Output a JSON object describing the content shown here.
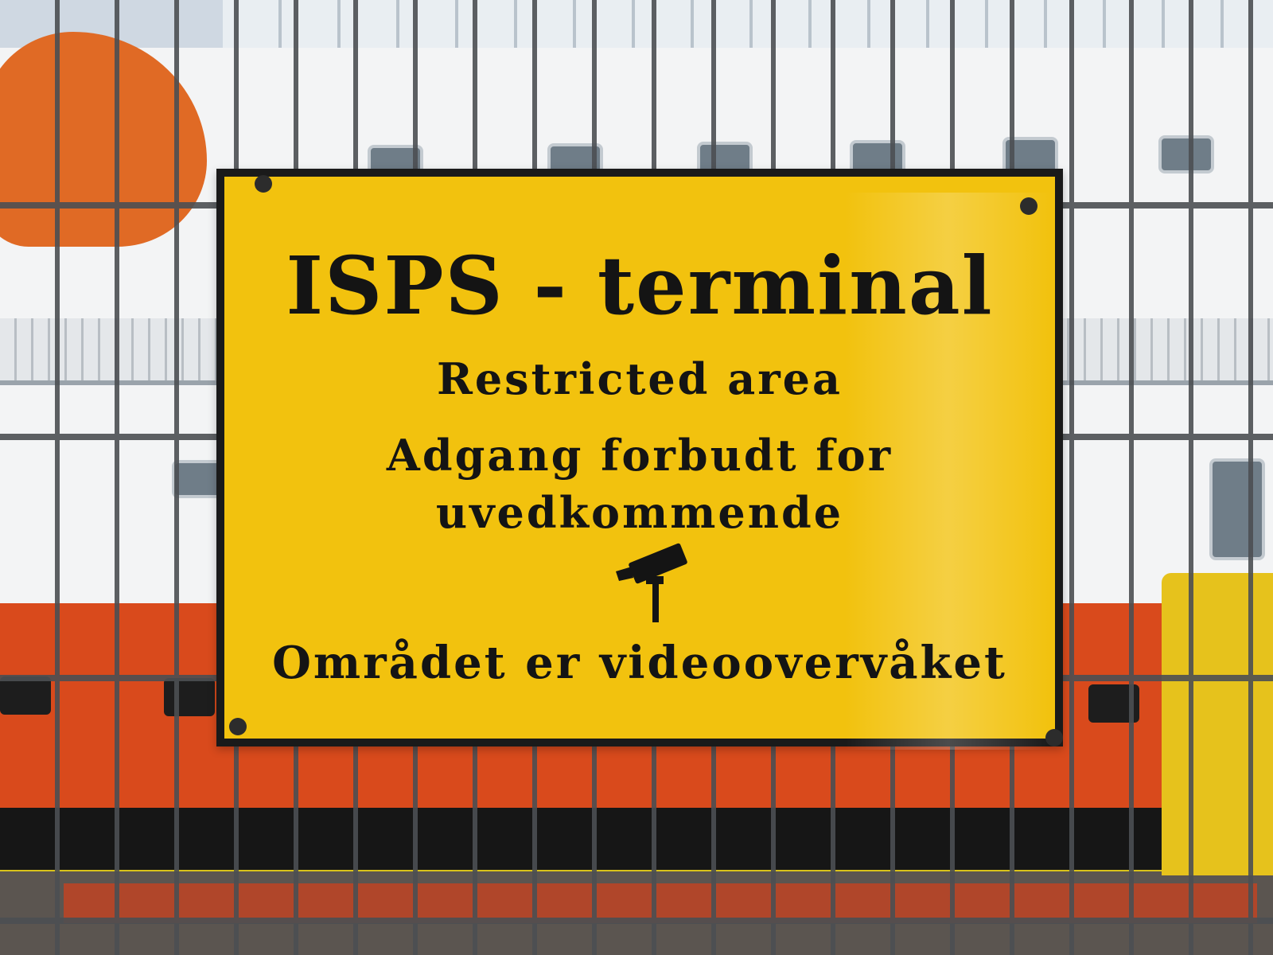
{
  "sign": {
    "title": "ISPS - terminal",
    "subtitle": "Restricted area",
    "line_1": "Adgang forbudt for",
    "line_2": "uvedkommende",
    "footer": "Området er videoovervåket",
    "background_color": "#f2c20e",
    "text_color": "#141414"
  },
  "icons": {
    "camera": "cctv-camera-icon"
  }
}
